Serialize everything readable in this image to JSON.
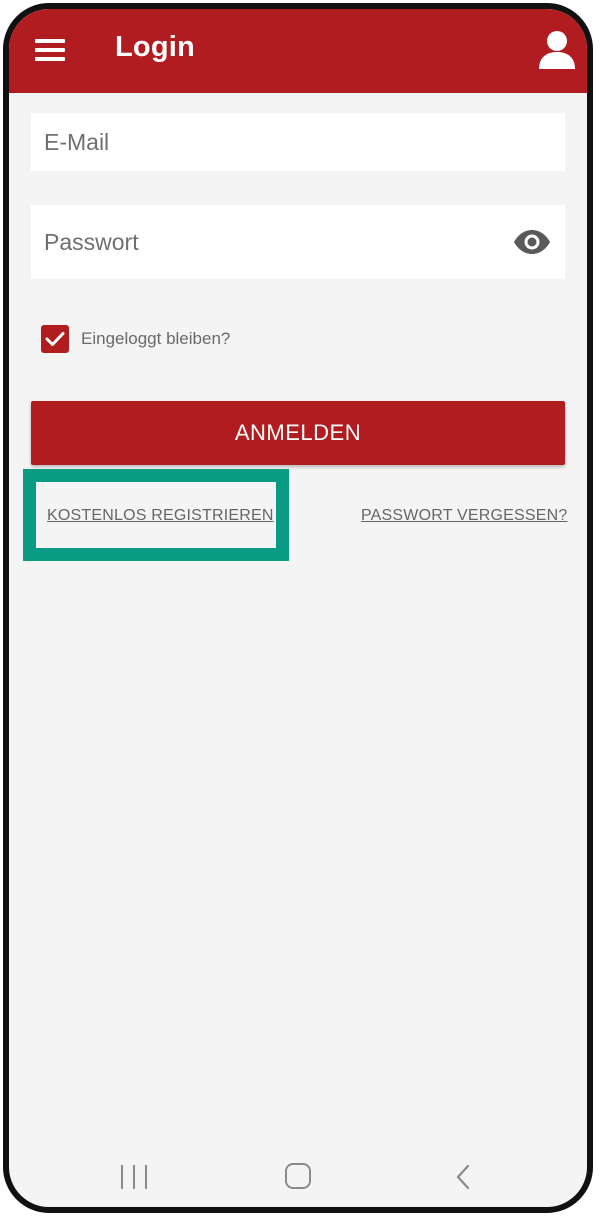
{
  "app_bar": {
    "title": "Login",
    "menu_icon": "hamburger-menu-icon",
    "profile_icon": "user-profile-icon",
    "color": "#b01c1f"
  },
  "form": {
    "email": {
      "placeholder": "E-Mail",
      "value": ""
    },
    "password": {
      "placeholder": "Passwort",
      "value": "",
      "toggle_icon": "eye-icon"
    },
    "remember": {
      "label": "Eingeloggt bleiben?",
      "checked": true
    },
    "login_button": "ANMELDEN"
  },
  "links": {
    "register": "KOSTENLOS REGISTRIEREN",
    "forgot_password": "PASSWORT VERGESSEN?"
  },
  "highlight": {
    "color": "#0a9b84"
  },
  "system_nav": {
    "recents_icon": "recents-icon",
    "home_icon": "home-icon",
    "back_icon": "back-icon"
  }
}
